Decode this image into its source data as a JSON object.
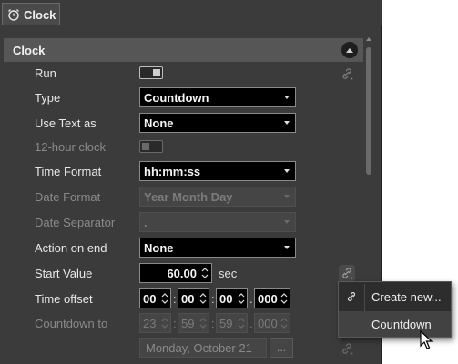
{
  "tab": {
    "label": "Clock",
    "icon": "alarm-clock-icon"
  },
  "section": {
    "title": "Clock"
  },
  "rows": {
    "run": {
      "label": "Run"
    },
    "type": {
      "label": "Type",
      "value": "Countdown"
    },
    "use_text_as": {
      "label": "Use Text as",
      "value": "None"
    },
    "hour12": {
      "label": "12-hour clock"
    },
    "time_format": {
      "label": "Time Format",
      "value": "hh:mm:ss"
    },
    "date_format": {
      "label": "Date Format",
      "value": "Year Month Day"
    },
    "date_separator": {
      "label": "Date Separator",
      "value": "."
    },
    "action_on_end": {
      "label": "Action on end",
      "value": "None"
    },
    "start_value": {
      "label": "Start Value",
      "value": "60.00",
      "unit": "sec"
    },
    "time_offset": {
      "label": "Time offset",
      "hh": "00",
      "mm": "00",
      "ss": "00",
      "ms": "000",
      "sep": ":",
      "dot": "."
    },
    "countdown_to": {
      "label": "Countdown to",
      "hh": "23",
      "mm": "59",
      "ss": "59",
      "ms": "000",
      "date": "Monday, October 21",
      "dots": "..."
    }
  },
  "popup": {
    "items": [
      {
        "label": "Create new...",
        "icon": "link-icon"
      },
      {
        "label": "Countdown"
      }
    ]
  },
  "colors": {
    "panel_bg": "#3b3b3b",
    "section_bg": "#565656",
    "field_bg": "#000000"
  }
}
